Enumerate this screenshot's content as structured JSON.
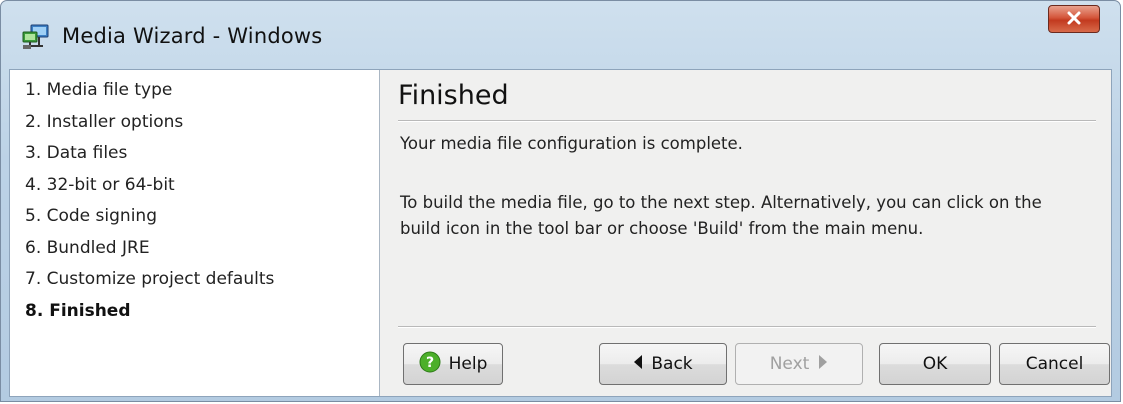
{
  "window": {
    "title": "Media Wizard - Windows",
    "close_glyph": "X"
  },
  "sidebar": {
    "steps": [
      {
        "label": "1. Media file type"
      },
      {
        "label": "2. Installer options"
      },
      {
        "label": "3. Data files"
      },
      {
        "label": "4. 32-bit or 64-bit"
      },
      {
        "label": "5. Code signing"
      },
      {
        "label": "6. Bundled JRE"
      },
      {
        "label": "7. Customize project defaults"
      },
      {
        "label": "8. Finished",
        "active": true
      }
    ]
  },
  "main": {
    "title": "Finished",
    "para1": "Your media file configuration is complete.",
    "para2": "To build the media file, go to the next step. Alternatively, you can click on the build icon in the tool bar or choose 'Build' from the main menu."
  },
  "buttons": {
    "help": "Help",
    "back": "Back",
    "next": "Next",
    "ok": "OK",
    "cancel": "Cancel"
  },
  "icons": {
    "app": "network-computer-icon",
    "help": "help-question-icon",
    "back": "arrow-left-icon",
    "next": "arrow-right-icon",
    "close": "close-icon"
  },
  "colors": {
    "titlebar": "#bcd2e6",
    "close_button": "#c23a1f",
    "panel_background": "#f0f0ef",
    "help_icon": "#4caf2a"
  }
}
